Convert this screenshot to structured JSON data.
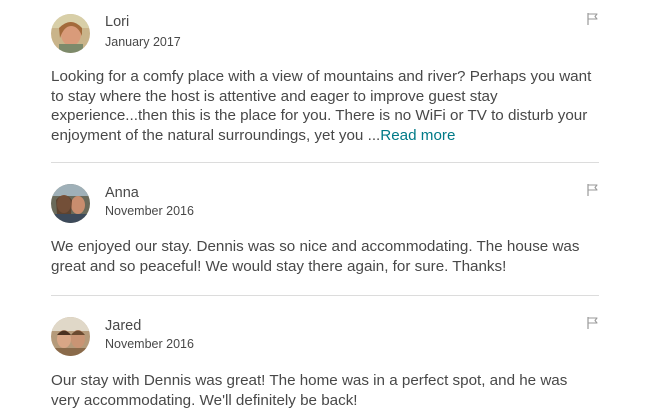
{
  "reviews": [
    {
      "name": "Lori",
      "date": "January 2017",
      "text": "Looking for a comfy place with a view of mountains and river? Perhaps you want to stay where the host is attentive and eager to improve guest stay experience...then this is the place for you. There is no WiFi or TV to disturb your enjoyment of the natural surroundings, yet you ...",
      "read_more": "Read more"
    },
    {
      "name": "Anna",
      "date": "November 2016",
      "text": "We enjoyed our stay. Dennis was so nice and accommodating. The house was great and so peaceful! We would stay there again, for sure. Thanks!"
    },
    {
      "name": "Jared",
      "date": "November 2016",
      "text": "Our stay with Dennis was great! The home was in a perfect spot, and he was very accommodating. We'll definitely be back!"
    }
  ],
  "colors": {
    "text": "#484848",
    "link": "#007a87",
    "divider": "#dcdcdc"
  },
  "icons": {
    "report": "flag-icon"
  }
}
